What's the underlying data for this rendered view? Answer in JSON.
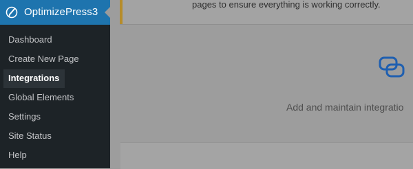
{
  "sidebar": {
    "brand": {
      "label": "OptimizePress3",
      "icon": "optimizepress-logo-icon"
    },
    "items": [
      {
        "label": "Dashboard",
        "active": false
      },
      {
        "label": "Create New Page",
        "active": false
      },
      {
        "label": "Integrations",
        "active": true
      },
      {
        "label": "Global Elements",
        "active": false
      },
      {
        "label": "Settings",
        "active": false
      },
      {
        "label": "Site Status",
        "active": false
      },
      {
        "label": "Help",
        "active": false
      }
    ]
  },
  "main": {
    "notice": {
      "text": "pages to ensure everything is working correctly.",
      "accent_color": "#b68c2a"
    },
    "integrations": {
      "icon": "integrations-icon",
      "icon_color": "#2271b1",
      "description": "Add and maintain integratio"
    }
  },
  "colors": {
    "sidebar_bg": "#1d2327",
    "brand_bg": "#1e74ae",
    "overlay_bg": "#9d9d9d"
  }
}
